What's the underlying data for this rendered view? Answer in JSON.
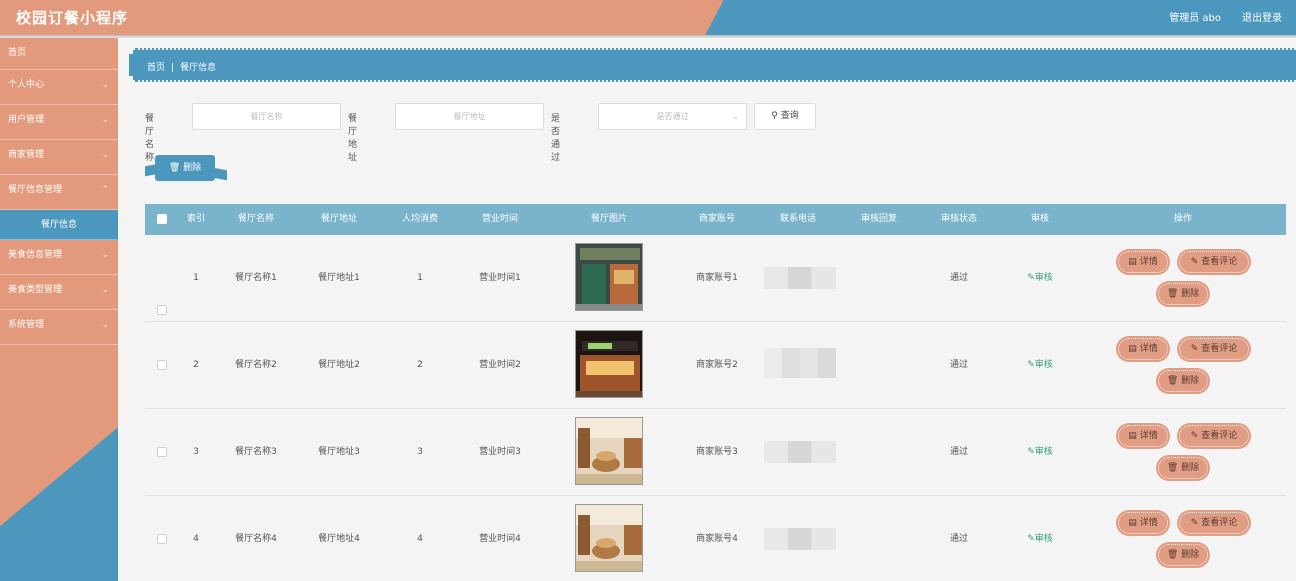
{
  "header": {
    "title": "校园订餐小程序",
    "user": "管理员 abo",
    "logout": "退出登录"
  },
  "sidebar": {
    "items": [
      {
        "label": "首页"
      },
      {
        "label": "个人中心"
      },
      {
        "label": "用户管理"
      },
      {
        "label": "商家管理"
      },
      {
        "label": "餐厅信息管理"
      },
      {
        "label": "餐厅信息"
      },
      {
        "label": "美食信息管理"
      },
      {
        "label": "美食类型管理"
      },
      {
        "label": "系统管理"
      }
    ]
  },
  "breadcrumb": {
    "home": "首页",
    "sep": "|",
    "current": "餐厅信息"
  },
  "search": {
    "name_label": "餐厅名称",
    "name_placeholder": "餐厅名称",
    "address_label": "餐厅地址",
    "address_placeholder": "餐厅地址",
    "pass_label": "是否通过",
    "pass_placeholder": "是否通过",
    "search_button": "查询"
  },
  "toolbar": {
    "delete_label": "删除"
  },
  "table": {
    "columns": [
      "索引",
      "餐厅名称",
      "餐厅地址",
      "人均消费",
      "营业时间",
      "餐厅图片",
      "商家账号",
      "联系电话",
      "审核回复",
      "审核状态",
      "审核",
      "操作"
    ],
    "rows": [
      {
        "index": "1",
        "name": "餐厅名称1",
        "address": "餐厅地址1",
        "avg": "1",
        "hours": "营业时间1",
        "account": "商家账号1",
        "status": "通过",
        "audit": "审核"
      },
      {
        "index": "2",
        "name": "餐厅名称2",
        "address": "餐厅地址2",
        "avg": "2",
        "hours": "营业时间2",
        "account": "商家账号2",
        "status": "通过",
        "audit": "审核"
      },
      {
        "index": "3",
        "name": "餐厅名称3",
        "address": "餐厅地址3",
        "avg": "3",
        "hours": "营业时间3",
        "account": "商家账号3",
        "status": "通过",
        "audit": "审核"
      },
      {
        "index": "4",
        "name": "餐厅名称4",
        "address": "餐厅地址4",
        "avg": "4",
        "hours": "营业时间4",
        "account": "商家账号4",
        "status": "通过",
        "audit": "审核"
      }
    ],
    "actions": {
      "detail": "详情",
      "comments": "查看评论",
      "delete": "删除"
    }
  },
  "colors": {
    "accent_orange": "#e39a7c",
    "accent_blue": "#4b97bd",
    "table_header": "#7ab3cc",
    "audit_green": "#3aa179"
  }
}
